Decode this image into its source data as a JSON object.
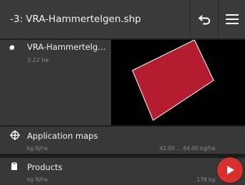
{
  "header": {
    "title": "-3: VRA-Hammertelgen.shp",
    "back_icon": "undo-arrow-icon",
    "menu_icon": "hamburger-menu-icon"
  },
  "file": {
    "name": "VRA-Hammertelgen.s...",
    "area": "3.22 ha",
    "icon": "file-dot-icon"
  },
  "map": {
    "field_color": "#b31d2f",
    "outline_color": "#ffffff",
    "background": "#000000"
  },
  "application_maps": {
    "title": "Application maps",
    "unit": "kg N/ha",
    "range": "42.00 ... 64.00 kg/ha",
    "icon": "crosshair-icon"
  },
  "products": {
    "title": "Products",
    "unit": "kg N/ha",
    "amount": "178 kg",
    "icon": "product-bag-icon"
  },
  "colors": {
    "header_bg": "#3a3a3a",
    "row_bg": "#383838",
    "accent_play": "#d8302c"
  }
}
